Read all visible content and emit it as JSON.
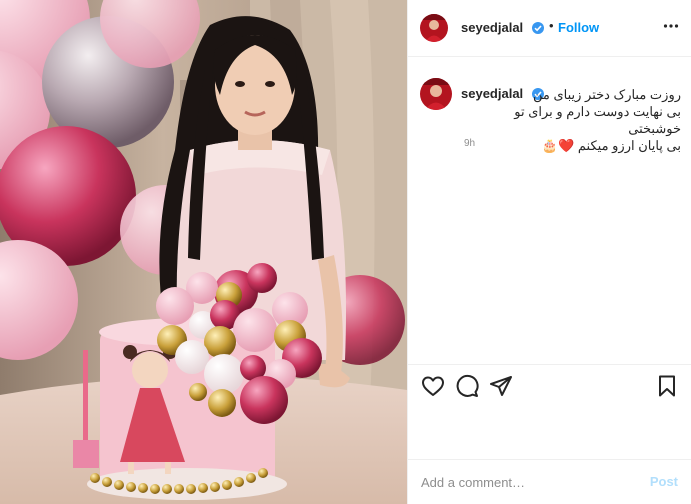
{
  "post": {
    "image_alt": "Girl with a birthday cake and balloons"
  },
  "header": {
    "username": "seyedjalal",
    "separator": "•",
    "follow_label": "Follow",
    "more_icon": "more-horizontal-icon",
    "verified_icon": "verified-badge-icon"
  },
  "caption": {
    "username": "seyedjalal",
    "text": "روزت مبارک دختر زیبای من\nبی نهایت دوست دارم و برای تو خوشبختی\nبی پایان ارزو میکنم ❤️🎂",
    "time": "9h"
  },
  "actions": {
    "like_icon": "heart-icon",
    "comment_icon": "comment-icon",
    "share_icon": "share-icon",
    "save_icon": "bookmark-icon"
  },
  "add_comment": {
    "placeholder": "Add a comment…",
    "post_label": "Post"
  },
  "colors": {
    "accent": "#0095f6",
    "post_disabled": "#b2dffc",
    "verified": "#3897f0",
    "text": "#262626",
    "muted": "#8e8e8e"
  }
}
